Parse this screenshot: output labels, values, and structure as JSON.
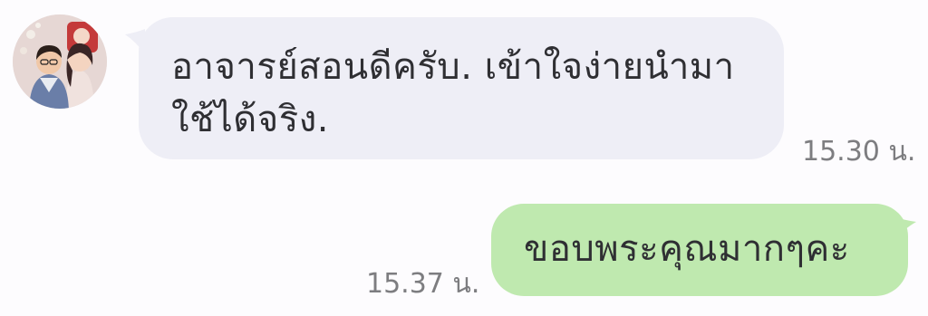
{
  "messages": [
    {
      "direction": "incoming",
      "text": "อาจารย์สอนดีครับ. เข้าใจง่ายนำมาใช้ได้จริง.",
      "time": "15.30 น."
    },
    {
      "direction": "outgoing",
      "text": "ขอบพระคุณมากๆคะ",
      "time": "15.37 น."
    }
  ],
  "colors": {
    "incoming_bubble": "#eeeef6",
    "outgoing_bubble": "#bfe9af",
    "timestamp": "#7d7d80",
    "text": "#2f2f33"
  }
}
